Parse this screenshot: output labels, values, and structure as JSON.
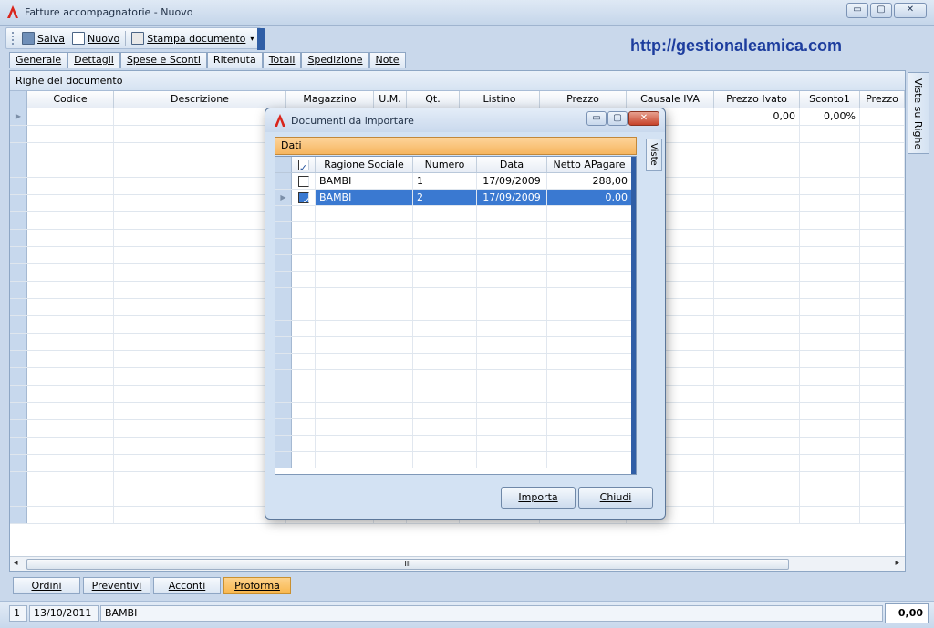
{
  "window": {
    "title": "Fatture accompagnatorie - Nuovo",
    "btn_minimize": "▭",
    "btn_maximize": "▢",
    "btn_close": "✕"
  },
  "toolbar": {
    "save": "Salva",
    "new": "Nuovo",
    "print": "Stampa documento",
    "print_dropdown": "▾"
  },
  "url": "http://gestionaleamica.com",
  "tabs": [
    "Generale",
    "Dettagli",
    "Spese e Sconti",
    "Ritenuta",
    "Totali",
    "Spedizione",
    "Note"
  ],
  "panel": {
    "title": "Righe del documento",
    "columns": [
      "Codice",
      "Descrizione",
      "Magazzino",
      "U.M.",
      "Qt.",
      "Listino",
      "Prezzo",
      "Causale IVA",
      "Prezzo Ivato",
      "Sconto1",
      "Prezzo"
    ],
    "first_row": {
      "prezzo_ivato": "0,00",
      "sconto1": "0,00%"
    },
    "side_tab": "Viste su Righe",
    "scroll_thumb": "III",
    "scroll_left": "◂",
    "scroll_right": "▸"
  },
  "bottom_tabs": [
    "Ordini",
    "Preventivi",
    "Acconti",
    "Proforma"
  ],
  "status": {
    "index": "1",
    "date": "13/10/2011",
    "customer": "BAMBI",
    "total": "0,00"
  },
  "dialog": {
    "title": "Documenti da importare",
    "section": "Dati",
    "side_tab": "Viste",
    "columns": [
      "Ragione Sociale",
      "Numero",
      "Data",
      "Netto APagare"
    ],
    "rows": [
      {
        "checked": false,
        "ragione_sociale": "BAMBI",
        "numero": "1",
        "data": "17/09/2009",
        "netto": "288,00"
      },
      {
        "checked": true,
        "ragione_sociale": "BAMBI",
        "numero": "2",
        "data": "17/09/2009",
        "netto": "0,00"
      }
    ],
    "btn_import": "Importa",
    "btn_close": "Chiudi"
  },
  "colors": {
    "accent_orange": "#f6b55f",
    "selection_blue": "#3a79d1",
    "url_blue": "#1d3d9e"
  }
}
